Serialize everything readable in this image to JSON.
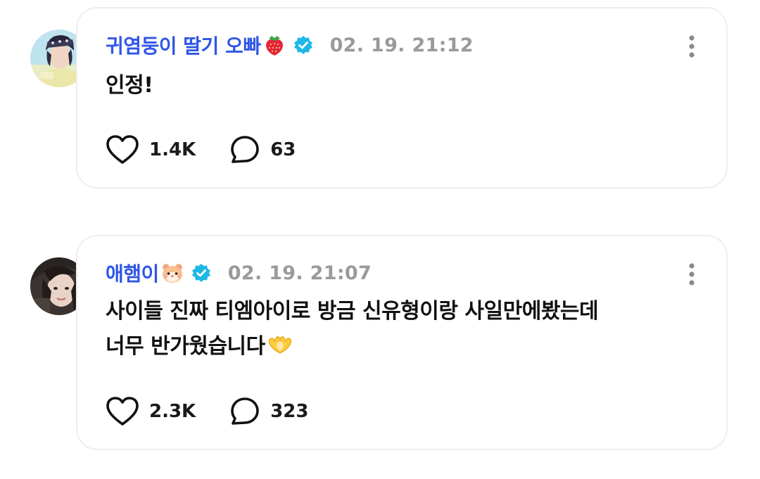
{
  "posts": [
    {
      "username": "귀염둥이 딸기 오빠",
      "username_emoji": "strawberry-emoji",
      "verified": true,
      "timestamp": "02. 19. 21:12",
      "lines": [
        "인정!"
      ],
      "likes": "1.4K",
      "comments": "63"
    },
    {
      "username": "애햄이",
      "username_emoji": "hamster-emoji",
      "verified": true,
      "timestamp": "02. 19. 21:07",
      "lines": [
        "사이들 진짜 티엠아이로 방금 신유형이랑 사일만에봤는데",
        "너무 반가웠습니다"
      ],
      "trailing_emoji": "heart-hands-emoji",
      "likes": "2.3K",
      "comments": "323"
    }
  ],
  "colors": {
    "username": "#2f55e8",
    "verified_badge": "#1fb8e6",
    "timestamp": "#9a9a9a",
    "text": "#111111",
    "card_border": "#eeeeee"
  },
  "icons": {
    "like": "heart-outline-icon",
    "comment": "speech-bubble-icon",
    "more": "vertical-dots-icon",
    "verified": "verified-badge-icon"
  }
}
